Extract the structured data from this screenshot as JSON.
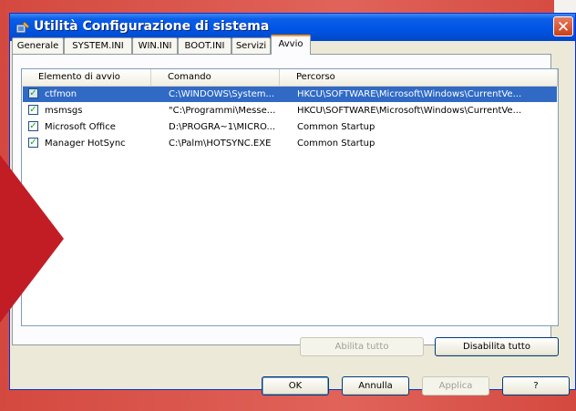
{
  "window": {
    "title": "Utilità Configurazione di sistema",
    "close_glyph": "✕"
  },
  "tabs": [
    {
      "label": "Generale"
    },
    {
      "label": "SYSTEM.INI"
    },
    {
      "label": "WIN.INI"
    },
    {
      "label": "BOOT.INI"
    },
    {
      "label": "Servizi"
    },
    {
      "label": "Avvio"
    }
  ],
  "active_tab": "Avvio",
  "list": {
    "columns": [
      "Elemento di avvio",
      "Comando",
      "Percorso"
    ],
    "rows": [
      {
        "item": "ctfmon",
        "command": "C:\\WINDOWS\\System...",
        "path": "HKCU\\SOFTWARE\\Microsoft\\Windows\\CurrentVe...",
        "checked": true,
        "selected": true
      },
      {
        "item": "msmsgs",
        "command": "\"C:\\Programmi\\Messe...",
        "path": "HKCU\\SOFTWARE\\Microsoft\\Windows\\CurrentVe...",
        "checked": true,
        "selected": false
      },
      {
        "item": "Microsoft Office",
        "command": "D:\\PROGRA~1\\MICRO...",
        "path": "Common Startup",
        "checked": true,
        "selected": false
      },
      {
        "item": "Manager HotSync",
        "command": "C:\\Palm\\HOTSYNC.EXE",
        "path": "Common Startup",
        "checked": true,
        "selected": false
      }
    ]
  },
  "buttons": {
    "enable_all": "Abilita tutto",
    "disable_all": "Disabilita tutto",
    "ok": "OK",
    "cancel": "Annulla",
    "apply": "Applica",
    "help": "?"
  },
  "colors": {
    "titlebar": "#0054e3",
    "selection": "#316ac5",
    "background_red": "#d9534a",
    "arrow": "#c21d25"
  }
}
